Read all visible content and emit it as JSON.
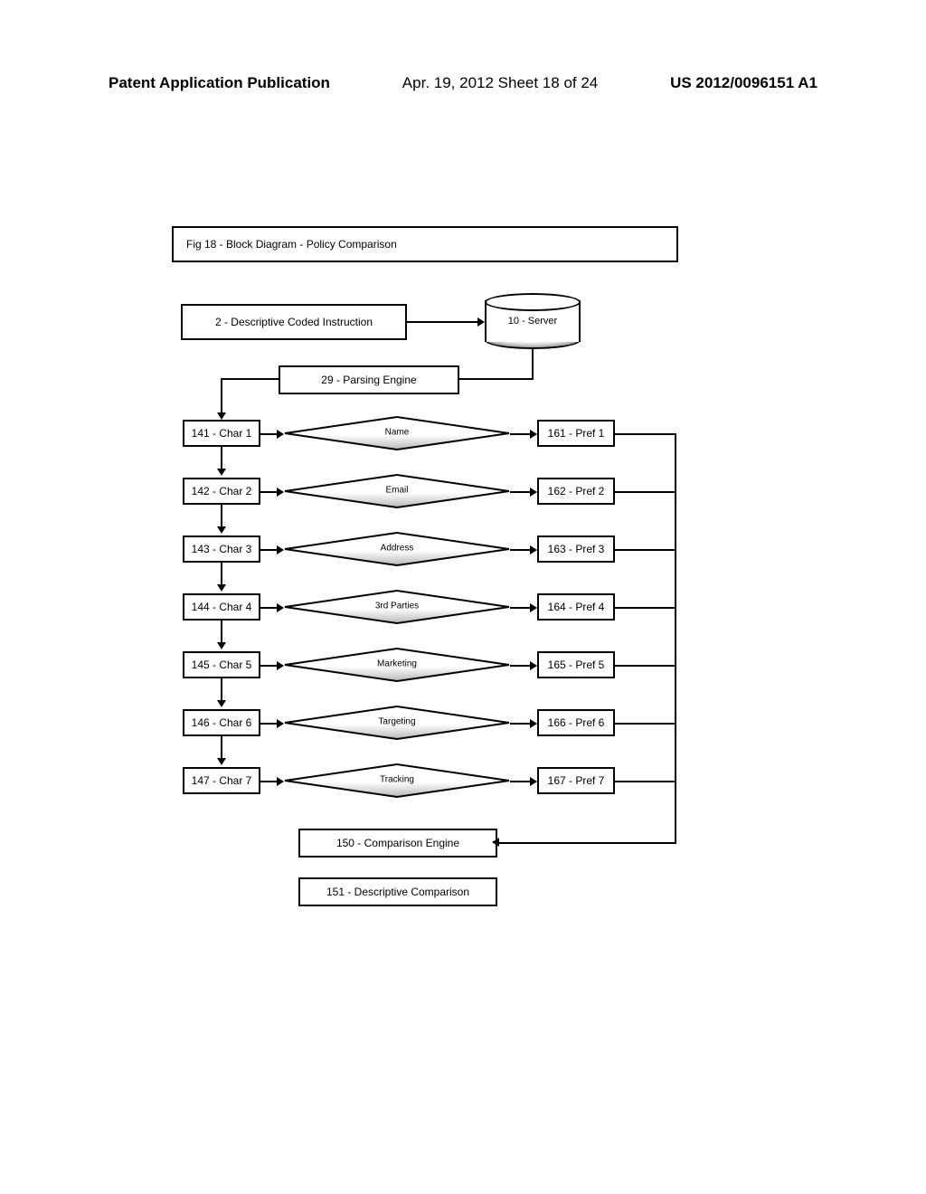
{
  "header": {
    "left": "Patent Application Publication",
    "mid": "Apr. 19, 2012  Sheet 18 of 24",
    "right": "US 2012/0096151 A1"
  },
  "diagram": {
    "title_box": "Fig 18 - Block Diagram - Policy Comparison",
    "instruction": "2 - Descriptive Coded Instruction",
    "server": "10 - Server",
    "parsing": "29 - Parsing Engine",
    "comparison_engine": "150 - Comparison Engine",
    "descriptive_comparison": "151 - Descriptive Comparison",
    "rows": [
      {
        "char": "141 - Char 1",
        "diamond": "Name",
        "pref": "161 - Pref 1"
      },
      {
        "char": "142 - Char 2",
        "diamond": "Email",
        "pref": "162 - Pref 2"
      },
      {
        "char": "143 - Char 3",
        "diamond": "Address",
        "pref": "163 - Pref 3"
      },
      {
        "char": "144 - Char 4",
        "diamond": "3rd Parties",
        "pref": "164 - Pref 4"
      },
      {
        "char": "145 - Char 5",
        "diamond": "Marketing",
        "pref": "165 - Pref 5"
      },
      {
        "char": "146 - Char 6",
        "diamond": "Targeting",
        "pref": "166 - Pref 6"
      },
      {
        "char": "147 - Char 7",
        "diamond": "Tracking",
        "pref": "167 - Pref 7"
      }
    ]
  }
}
